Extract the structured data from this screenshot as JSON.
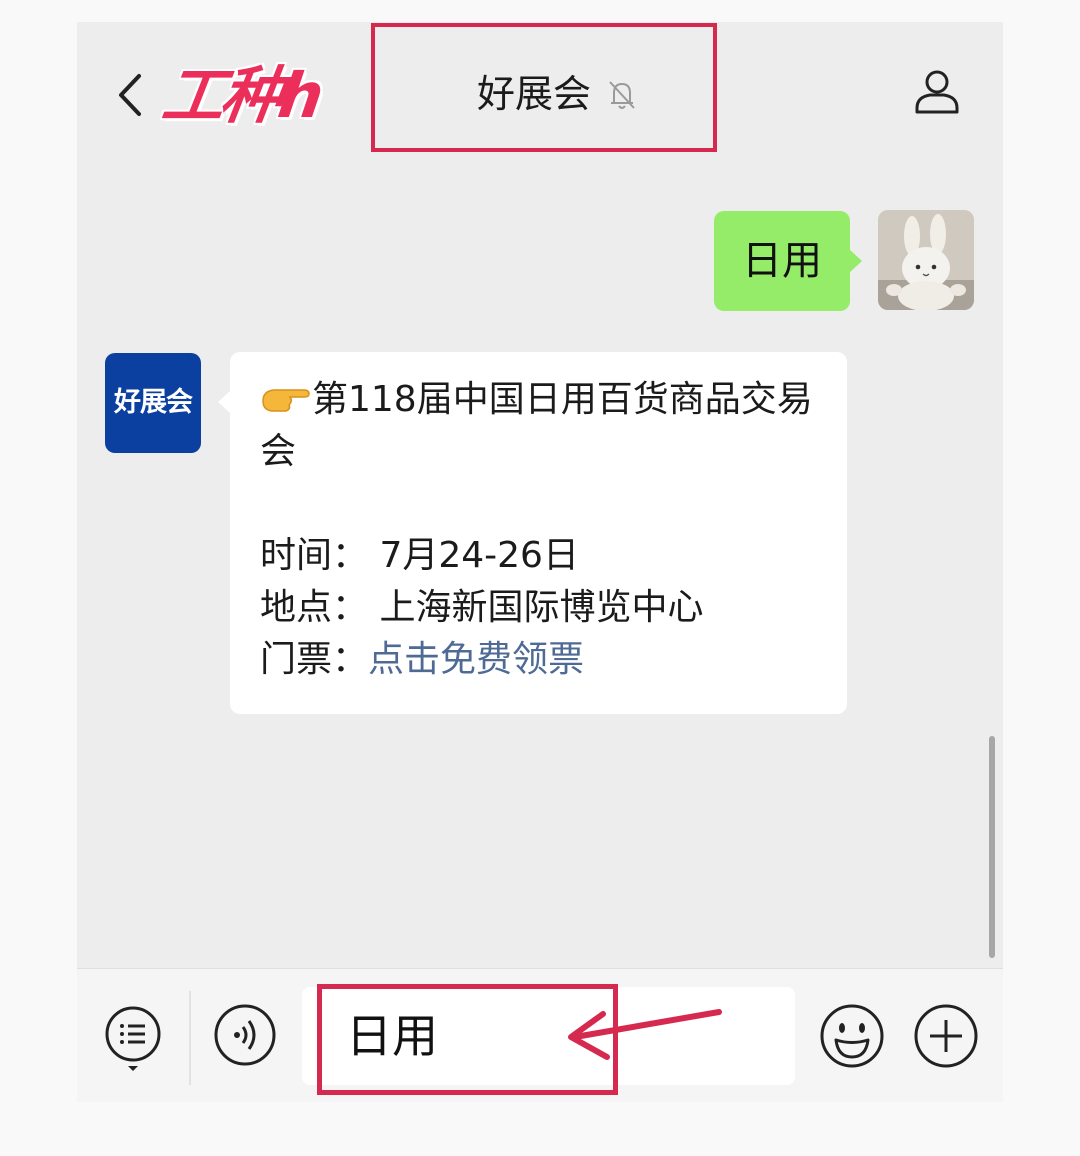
{
  "header": {
    "watermark": "工种h",
    "title": "好展会",
    "icons": [
      "back-icon",
      "mute-bell-icon",
      "profile-icon"
    ]
  },
  "messages": [
    {
      "from": "me",
      "text": "日用"
    },
    {
      "from": "them",
      "avatar_text": "好展会",
      "line1": "第118届中国日用百货商品交易会",
      "time": "时间： 7月24-26日",
      "place": "地点： 上海新国际博览中心",
      "ticket_label": "门票：",
      "ticket_link": "点击免费领票"
    }
  ],
  "input": {
    "value": "日用",
    "icons": [
      "menu-icon",
      "voice-icon",
      "emoji-icon",
      "plus-icon"
    ]
  },
  "colors": {
    "highlight": "#d6294f",
    "my_bubble": "#95ec69",
    "link": "#4f6b95",
    "official_avatar": "#0b3fa0"
  }
}
